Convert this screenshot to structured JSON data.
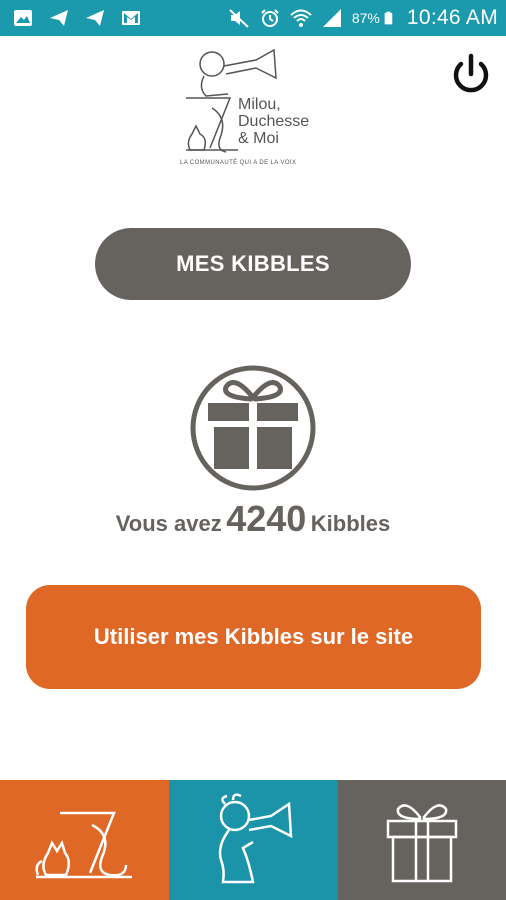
{
  "status_bar": {
    "battery_percent": "87%",
    "time": "10:46 AM",
    "left_icons": [
      "gallery-icon",
      "send-icon",
      "send-icon",
      "gmail-icon"
    ],
    "right_icons": [
      "mute-icon",
      "alarm-icon",
      "wifi-icon",
      "signal-icon",
      "battery-icon"
    ]
  },
  "header": {
    "logo_lines": [
      "Milou,",
      "Duchesse",
      "& Moi"
    ],
    "tagline": "LA COMMUNAUTÉ QUI A DE LA VOIX"
  },
  "mes_kibbles_label": "MES KIBBLES",
  "balance": {
    "prefix": "Vous avez",
    "amount": "4240",
    "suffix": "Kibbles"
  },
  "use_button_label": "Utiliser mes Kibbles sur le site",
  "bottom_nav": [
    {
      "icon": "dog-cat-icon",
      "color": "#df6827"
    },
    {
      "icon": "trumpet-boy-icon",
      "color": "#1b93a8"
    },
    {
      "icon": "gift-icon",
      "color": "#66625e"
    }
  ],
  "colors": {
    "teal": "#1b9aae",
    "orange": "#df6827",
    "gray": "#66625e"
  }
}
